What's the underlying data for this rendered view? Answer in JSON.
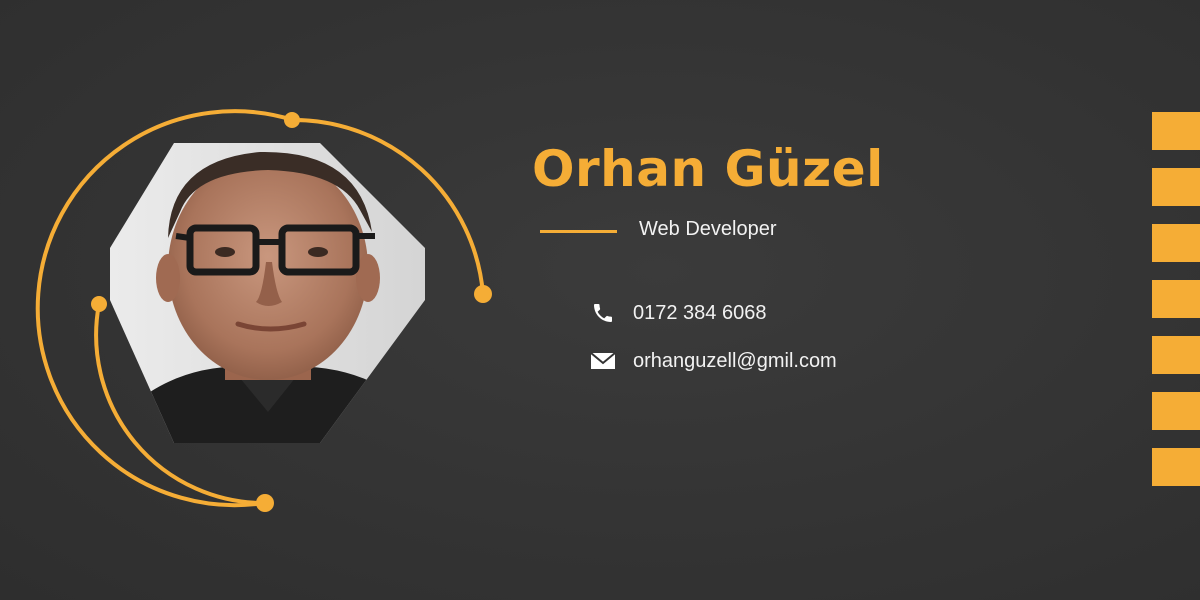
{
  "profile": {
    "name": "Orhan Güzel",
    "job_title": "Web Developer",
    "photo_icon": "person-portrait"
  },
  "contact": {
    "phone": {
      "icon": "phone-icon",
      "text": "0172 384 6068"
    },
    "email": {
      "icon": "envelope-icon",
      "text": "orhanguzell@gmil.com"
    }
  },
  "colors": {
    "background": "#333333",
    "accent": "#F5AD36",
    "text": "#f2f2f2"
  }
}
